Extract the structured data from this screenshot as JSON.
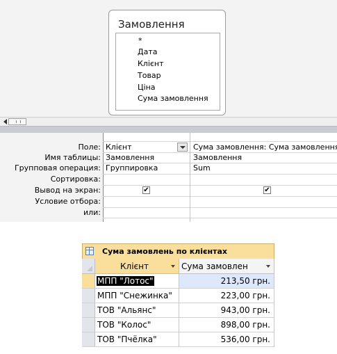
{
  "table_box": {
    "title": "Замовлення",
    "fields": [
      "*",
      "Дата",
      "Клієнт",
      "Товар",
      "Ціна",
      "Сума замовлення"
    ]
  },
  "grid": {
    "row_labels": [
      "Поле:",
      "Имя таблицы:",
      "Групповая операция:",
      "Сортировка:",
      "Вывод на экран:",
      "Условие отбора:",
      "или:"
    ],
    "col1": {
      "field": "Клієнт",
      "table": "Замовлення",
      "group": "Группировка",
      "sort": "",
      "show": true
    },
    "col2": {
      "field": "Сума замовлення: Сума замовлення",
      "table": "Замовлення",
      "group": "Sum",
      "sort": "",
      "show": true
    },
    "check_mark": "✔"
  },
  "result": {
    "title": "Сума замовлень по клієнтах",
    "columns": [
      "Клієнт",
      "Сума замовлен"
    ],
    "rows": [
      {
        "client": "МПП \"Лотос\"",
        "sum": "213,50 грн."
      },
      {
        "client": "МПП \"Снежинка\"",
        "sum": "223,00 грн."
      },
      {
        "client": "ТОВ \"Альянс\"",
        "sum": "943,00 грн."
      },
      {
        "client": "ТОВ \"Колос\"",
        "sum": "898,00 грн."
      },
      {
        "client": "ТОВ \"Пчёлка\"",
        "sum": "536,00 грн."
      }
    ]
  }
}
